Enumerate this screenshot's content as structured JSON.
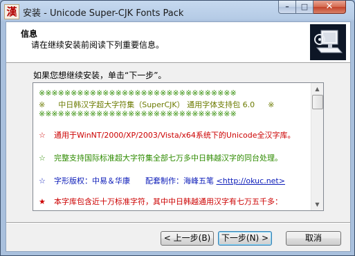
{
  "window": {
    "icon_glyph": "漢",
    "title": "安装 - Unicode Super-CJK Fonts Pack",
    "controls": {
      "minimize": "–",
      "maximize": "□",
      "close": "✕"
    }
  },
  "header": {
    "title": "信息",
    "subtitle": "请在继续安装前阅读下列重要信息。",
    "image_icon": "computer-install-icon"
  },
  "body": {
    "intro": "如果您想继续安装，单击“下一步”。"
  },
  "readme": {
    "stars_top": "※※※※※※※※※※※※※※※※※※※※※※※※※※※※※※※",
    "banner_left": "※",
    "banner_text": "中日韩汉字超大字符集（SuperCJK） 通用字体支持包 6.0",
    "banner_right": "※",
    "stars_bottom": "※※※※※※※※※※※※※※※※※※※※※※※※※※※※※※※",
    "items": [
      {
        "mark": "☆",
        "text": "通用于WinNT/2000/XP/2003/Vista/x64系统下的Unicode全汉字库。"
      },
      {
        "mark": "☆",
        "text": "完整支持国际标准超大字符集全部七万多中日韩越汉字的同台处理。"
      },
      {
        "mark": "☆",
        "text": "字形版权：中易＆华康　　配套制作：海峰五笔",
        "link": "<http://okuc.net>"
      },
      {
        "mark": "★",
        "text": "本字库包含近十万标准字符，其中中日韩越通用汉字有七万五千多："
      }
    ],
    "scroll_up": "▲",
    "scroll_down": "▼"
  },
  "buttons": {
    "back": "< 上一步(B)",
    "next": "下一步(N) >",
    "cancel": "取消"
  },
  "colors": {
    "stars": "#2e8b00",
    "banner": "#6b7a00",
    "item_mark": "#cc0000",
    "item_red": "#cc0000",
    "item_green": "#2e8b00",
    "item_blue": "#0a1ab8",
    "titlebar": "#b5cbe6",
    "close_button": "#c3432a"
  }
}
